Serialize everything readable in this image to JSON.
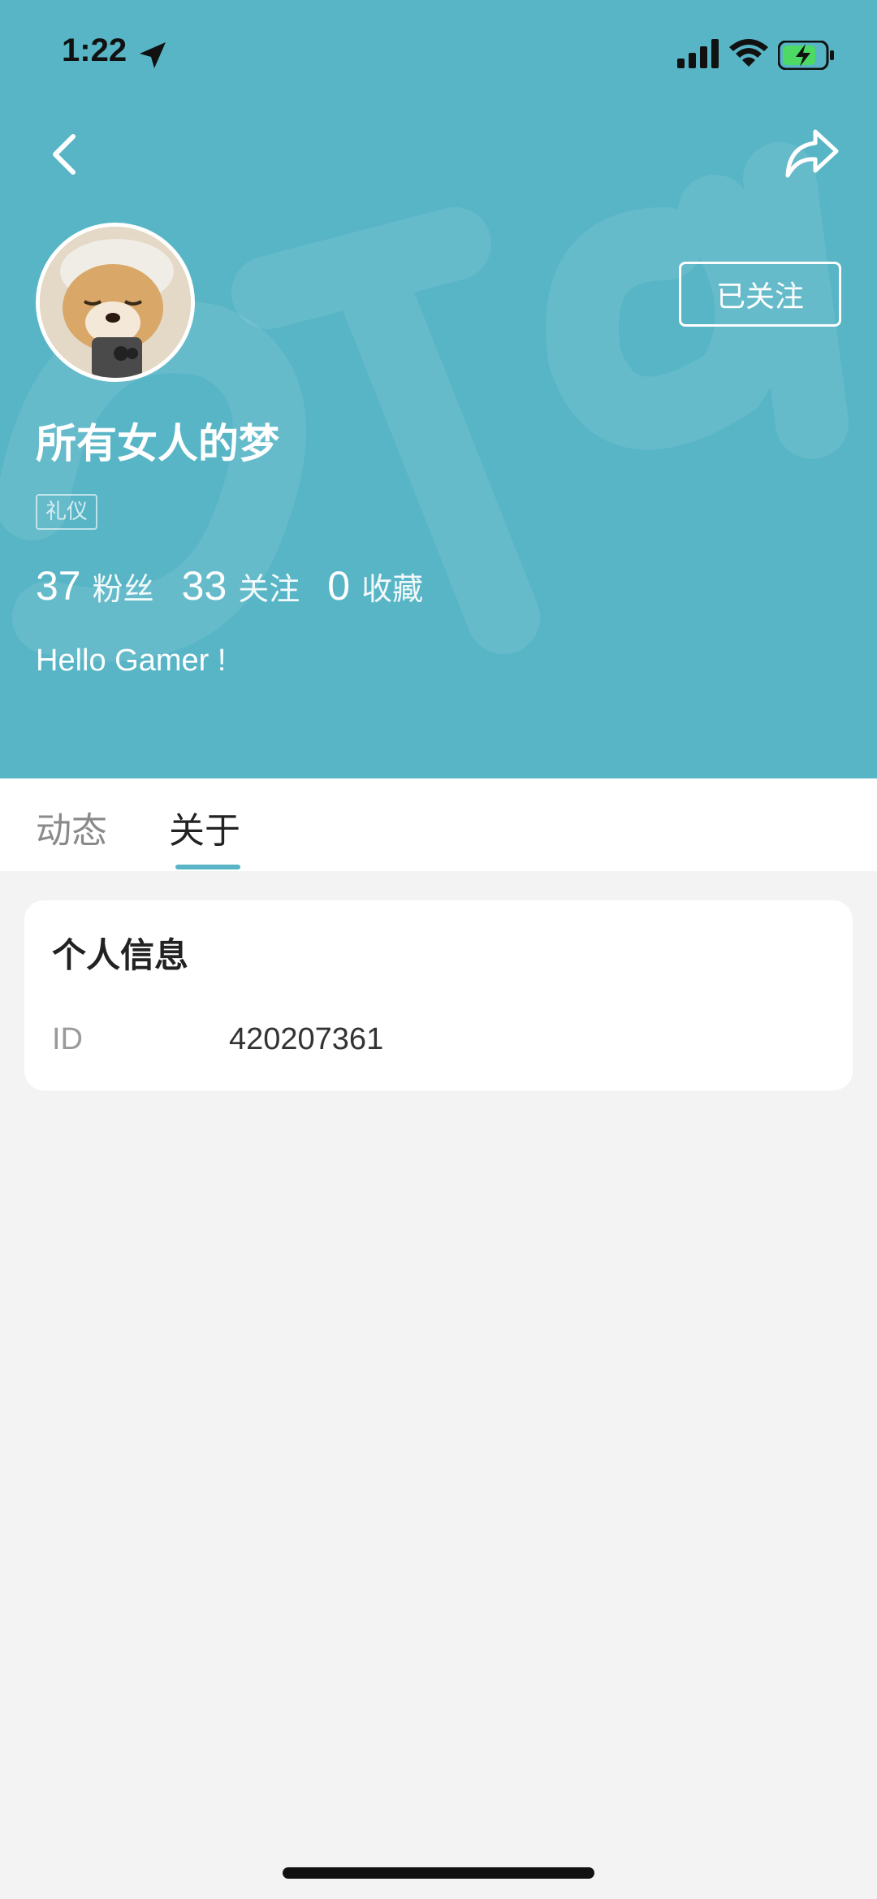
{
  "status_bar": {
    "time": "1:22",
    "icons": [
      "location-arrow-icon",
      "cellular-signal-icon",
      "wifi-icon",
      "battery-charging-icon"
    ]
  },
  "nav": {
    "back_icon": "chevron-left-icon",
    "share_icon": "share-icon"
  },
  "colors": {
    "header_bg": "#57b5c6",
    "accent": "#57b5c6",
    "page_bg": "#f3f3f3"
  },
  "profile": {
    "avatar": "avatar",
    "follow_label": "已关注",
    "username": "所有女人的梦",
    "tag": "礼仪",
    "stats": [
      {
        "value": "37",
        "label": "粉丝"
      },
      {
        "value": "33",
        "label": "关注"
      },
      {
        "value": "0",
        "label": "收藏"
      }
    ],
    "bio": "Hello Gamer !"
  },
  "tabs": [
    {
      "label": "动态",
      "active": false
    },
    {
      "label": "关于",
      "active": true
    }
  ],
  "info": {
    "title": "个人信息",
    "rows": [
      {
        "label": "ID",
        "value": "420207361"
      }
    ]
  }
}
